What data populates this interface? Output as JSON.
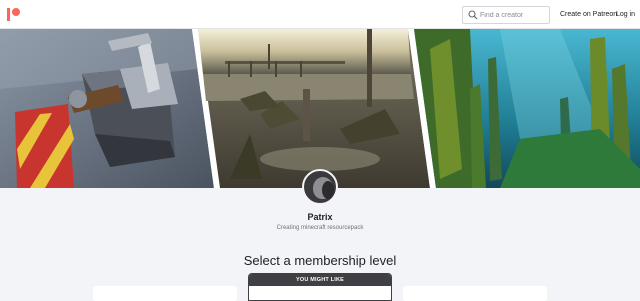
{
  "navbar": {
    "logo_icon": "patreon-logo-icon",
    "brand_color": "#f96854",
    "search": {
      "placeholder": "Find a creator",
      "icon": "search-icon"
    },
    "create_link": "Create on Patreon",
    "login_link": "Log in"
  },
  "cover": {
    "panels": [
      {
        "name": "anvil-scene"
      },
      {
        "name": "swamp-pier-scene"
      },
      {
        "name": "underwater-kelp-scene"
      }
    ]
  },
  "creator": {
    "name": "Patrix",
    "tagline": "Creating minecraft resourcepack"
  },
  "membership": {
    "title": "Select a membership level",
    "featured_badge": "YOU MIGHT LIKE"
  }
}
